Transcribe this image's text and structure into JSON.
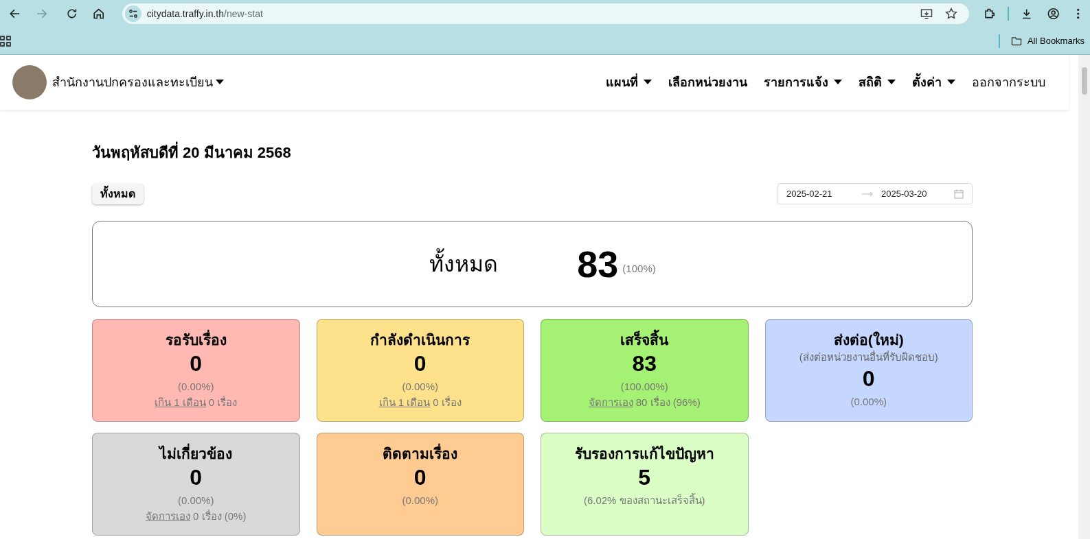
{
  "browser": {
    "url_host": "citydata.traffy.in.th",
    "url_path": "/new-stat",
    "bookmarks_label": "All Bookmarks"
  },
  "navbar": {
    "org_name": "สำนักงานปกครองและทะเบียน",
    "items": [
      {
        "label": "แผนที่",
        "dropdown": true,
        "bold": true
      },
      {
        "label": "เลือกหน่วยงาน",
        "dropdown": false,
        "bold": true
      },
      {
        "label": "รายการแจ้ง",
        "dropdown": true,
        "bold": true
      },
      {
        "label": "สถิติ",
        "dropdown": true,
        "bold": true
      },
      {
        "label": "ตั้งค่า",
        "dropdown": true,
        "bold": true
      },
      {
        "label": "ออกจากระบบ",
        "dropdown": false,
        "bold": false
      }
    ]
  },
  "date_title": "วันพฤหัสบดีที่ 20 มีนาคม 2568",
  "filter_button": "ทั้งหมด",
  "date_range": {
    "start": "2025-02-21",
    "end": "2025-03-20"
  },
  "total": {
    "label": "ทั้งหมด",
    "count": "83",
    "percent": "(100%)"
  },
  "cards": [
    {
      "title": "รอรับเรื่อง",
      "count": "0",
      "percent": "(0.00%)",
      "color": "#ffb9b2",
      "footer_link": "เกิน 1 เดือน",
      "footer_text": "0 เรื่อง"
    },
    {
      "title": "กำลังดำเนินการ",
      "count": "0",
      "percent": "(0.00%)",
      "color": "#fde18b",
      "footer_link": "เกิน 1 เดือน",
      "footer_text": "0 เรื่อง"
    },
    {
      "title": "เสร็จสิ้น",
      "count": "83",
      "percent": "(100.00%)",
      "color": "#a5f173",
      "footer_link": "จัดการเอง",
      "footer_text": "80 เรื่อง (96%)"
    },
    {
      "title": "ส่งต่อ(ใหม่)",
      "subtitle": "(ส่งต่อหน่วยงานอื่นที่รับผิดชอบ)",
      "count": "0",
      "percent": "(0.00%)",
      "color": "#c5d7fe"
    },
    {
      "title": "ไม่เกี่ยวข้อง",
      "count": "0",
      "percent": "(0.00%)",
      "color": "#d9d9d9",
      "footer_link": "จัดการเอง",
      "footer_text": "0 เรื่อง (0%)"
    },
    {
      "title": "ติดตามเรื่อง",
      "count": "0",
      "percent": "(0.00%)",
      "color": "#fecb93"
    },
    {
      "title": "รับรองการแก้ไขปัญหา",
      "count": "5",
      "percent": "(6.02% ของสถานะเสร็จสิ้น)",
      "color": "#dbfdc6"
    }
  ]
}
